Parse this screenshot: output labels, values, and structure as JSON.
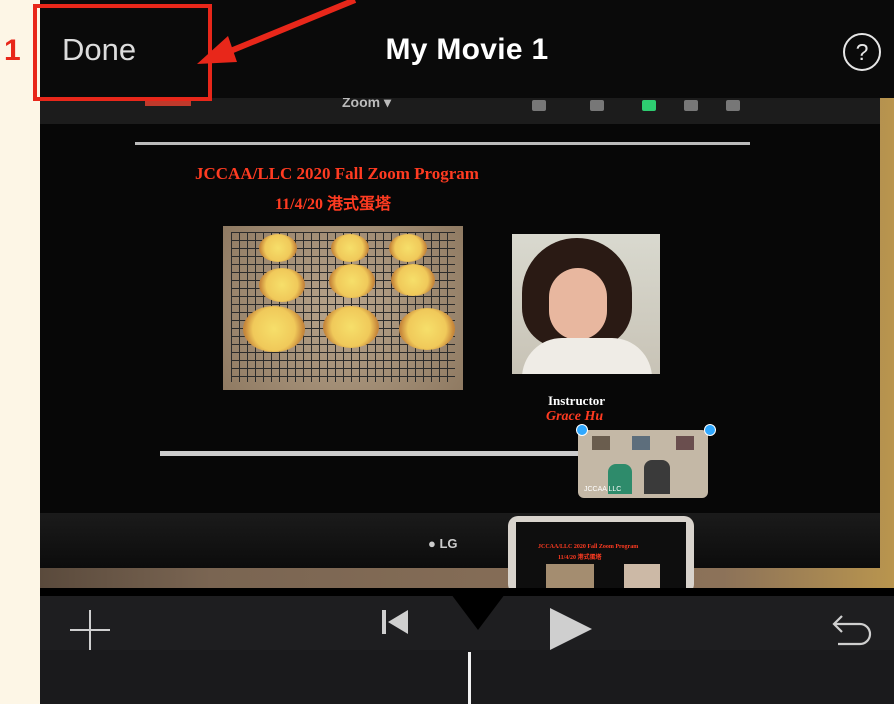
{
  "navbar": {
    "done_label": "Done",
    "title": "My Movie 1",
    "help_label": "?"
  },
  "preview": {
    "zoom_label": "Zoom ▾",
    "slide_title": "JCCAA/LLC 2020 Fall Zoom Program",
    "slide_subtitle": "11/4/20 港式蛋塔",
    "instructor_label": "Instructor",
    "instructor_name": "Grace Hu",
    "pip_label": "JCCAA LLC",
    "tv_brand": "● LG",
    "tablet_title": "JCCAA/LLC 2020 Fall Zoom Program",
    "tablet_subtitle": "11/4/20 港式蛋塔"
  },
  "controls": {
    "add_icon": "plus-icon",
    "rewind_icon": "skip-to-start-icon",
    "play_icon": "play-icon",
    "undo_icon": "undo-icon"
  },
  "annotation": {
    "step_number": "1",
    "color": "#e8271a"
  }
}
